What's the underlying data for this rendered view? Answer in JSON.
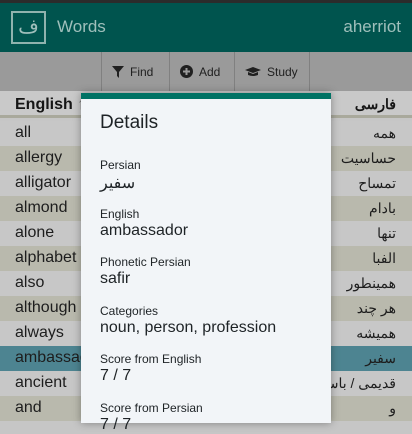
{
  "header": {
    "logo": "ف",
    "title": "Words",
    "user": "aherriot"
  },
  "toolbar": {
    "find": "Find",
    "add": "Add",
    "study": "Study"
  },
  "table": {
    "col_english": "English",
    "sort_icon": "↑",
    "col_persian": "فارسی",
    "rows": [
      {
        "en": "all",
        "fa": "همه"
      },
      {
        "en": "allergy",
        "fa": "حساسیت"
      },
      {
        "en": "alligator",
        "fa": "تمساح"
      },
      {
        "en": "almond",
        "fa": "بادام"
      },
      {
        "en": "alone",
        "fa": "تنها"
      },
      {
        "en": "alphabet",
        "fa": "الفبا"
      },
      {
        "en": "also",
        "fa": "همینطور"
      },
      {
        "en": "although",
        "fa": "هر چند"
      },
      {
        "en": "always",
        "fa": "همیشه"
      },
      {
        "en": "ambassador",
        "fa": "سفیر",
        "selected": true
      },
      {
        "en": "ancient",
        "fa": "قدیمی / باستانی"
      },
      {
        "en": "and",
        "fa": "و"
      }
    ]
  },
  "details": {
    "title": "Details",
    "fields": [
      {
        "label": "Persian",
        "value": "سفیر"
      },
      {
        "label": "English",
        "value": "ambassador"
      },
      {
        "label": "Phonetic Persian",
        "value": "safir"
      },
      {
        "label": "Categories",
        "value": "noun, person, profession"
      },
      {
        "label": "Score from English",
        "value": "7 / 7"
      },
      {
        "label": "Score from Persian",
        "value": "7 / 7"
      }
    ]
  }
}
